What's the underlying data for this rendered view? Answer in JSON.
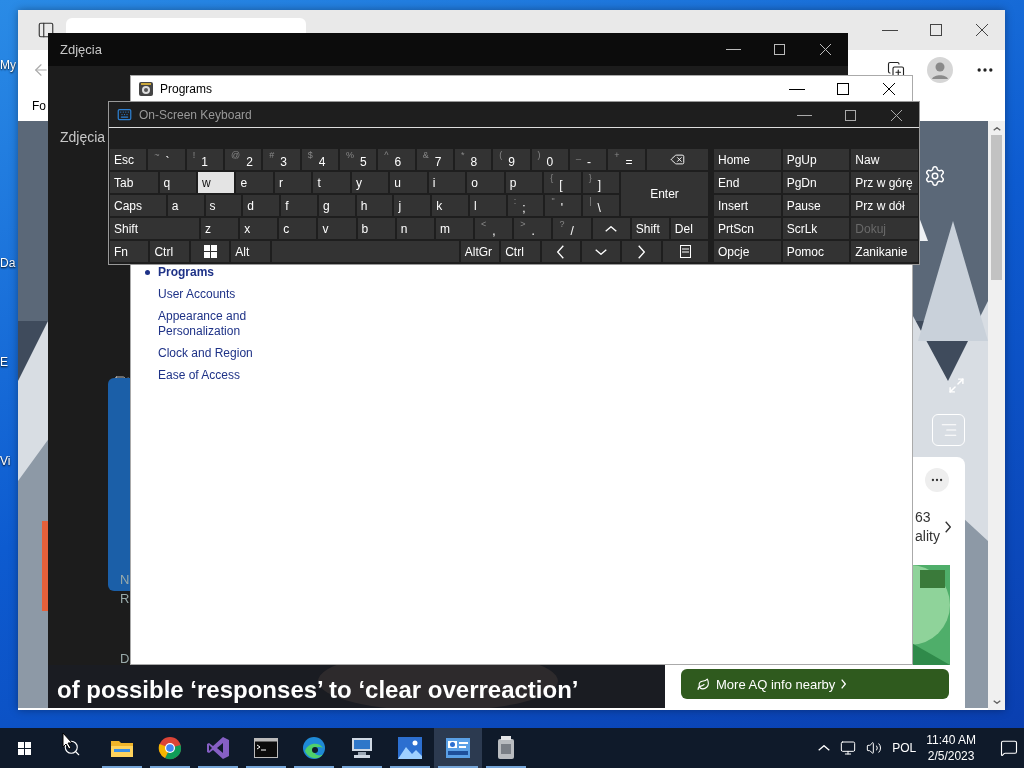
{
  "desktop": {
    "icon_labels": [
      "My",
      "Da",
      "E",
      "Vi"
    ]
  },
  "browser": {
    "favorites_text": "Fo",
    "headline": "of possible ‘responses’ to ‘clear overreaction’",
    "card": {
      "reading": "63",
      "caption": "ality",
      "button": "More AQ info nearby"
    }
  },
  "photos_window": {
    "title": "Zdjęcia",
    "nav_label": "Zdjęcia",
    "card_letters": [
      "N",
      "R"
    ],
    "footer_letter": "D"
  },
  "programs_window": {
    "title": "Programs",
    "nav": [
      {
        "label": "Programs",
        "selected": true
      },
      {
        "label": "User Accounts",
        "selected": false
      },
      {
        "label": "Appearance and Personalization",
        "selected": false
      },
      {
        "label": "Clock and Region",
        "selected": false
      },
      {
        "label": "Ease of Access",
        "selected": false
      }
    ]
  },
  "keyboard_window": {
    "title": "On-Screen Keyboard",
    "active": false,
    "main_rows": [
      [
        {
          "kind": "text",
          "label": "Esc",
          "selected": false
        },
        {
          "kind": "dual",
          "shift": "~",
          "label": "`",
          "selected": false
        },
        {
          "kind": "dual",
          "shift": "!",
          "label": "1",
          "selected": false
        },
        {
          "kind": "dual",
          "shift": "@",
          "label": "2",
          "selected": false
        },
        {
          "kind": "dual",
          "shift": "#",
          "label": "3",
          "selected": false
        },
        {
          "kind": "dual",
          "shift": "$",
          "label": "4",
          "selected": false
        },
        {
          "kind": "dual",
          "shift": "%",
          "label": "5",
          "selected": false
        },
        {
          "kind": "dual",
          "shift": "^",
          "label": "6",
          "selected": false
        },
        {
          "kind": "dual",
          "shift": "&",
          "label": "7",
          "selected": false
        },
        {
          "kind": "dual",
          "shift": "*",
          "label": "8",
          "selected": false
        },
        {
          "kind": "dual",
          "shift": "(",
          "label": "9",
          "selected": false
        },
        {
          "kind": "dual",
          "shift": ")",
          "label": "0",
          "selected": false
        },
        {
          "kind": "dual",
          "shift": "_",
          "label": "-",
          "selected": false
        },
        {
          "kind": "dual",
          "shift": "+",
          "label": "=",
          "selected": false
        },
        {
          "kind": "backspace",
          "selected": false
        }
      ],
      [
        {
          "kind": "text",
          "label": "Tab",
          "selected": false
        },
        {
          "kind": "text",
          "label": "q",
          "selected": false
        },
        {
          "kind": "text",
          "label": "w",
          "selected": true
        },
        {
          "kind": "text",
          "label": "e",
          "selected": false
        },
        {
          "kind": "text",
          "label": "r",
          "selected": false
        },
        {
          "kind": "text",
          "label": "t",
          "selected": false
        },
        {
          "kind": "text",
          "label": "y",
          "selected": false
        },
        {
          "kind": "text",
          "label": "u",
          "selected": false
        },
        {
          "kind": "text",
          "label": "i",
          "selected": false
        },
        {
          "kind": "text",
          "label": "o",
          "selected": false
        },
        {
          "kind": "text",
          "label": "p",
          "selected": false
        },
        {
          "kind": "dual",
          "shift": "{",
          "label": "[",
          "selected": false
        },
        {
          "kind": "dual",
          "shift": "}",
          "label": "]",
          "selected": false
        },
        {
          "kind": "enter",
          "label": "Enter",
          "selected": false
        }
      ],
      [
        {
          "kind": "text",
          "label": "Caps",
          "selected": false
        },
        {
          "kind": "text",
          "label": "a",
          "selected": false
        },
        {
          "kind": "text",
          "label": "s",
          "selected": false
        },
        {
          "kind": "text",
          "label": "d",
          "selected": false
        },
        {
          "kind": "text",
          "label": "f",
          "selected": false
        },
        {
          "kind": "text",
          "label": "g",
          "selected": false
        },
        {
          "kind": "text",
          "label": "h",
          "selected": false
        },
        {
          "kind": "text",
          "label": "j",
          "selected": false
        },
        {
          "kind": "text",
          "label": "k",
          "selected": false
        },
        {
          "kind": "text",
          "label": "l",
          "selected": false
        },
        {
          "kind": "dual",
          "shift": ":",
          "label": ";",
          "selected": false
        },
        {
          "kind": "dual",
          "shift": "\"",
          "label": "'",
          "selected": false
        },
        {
          "kind": "dual",
          "shift": "|",
          "label": "\\",
          "selected": false
        }
      ],
      [
        {
          "kind": "text",
          "label": "Shift",
          "selected": false
        },
        {
          "kind": "text",
          "label": "z",
          "selected": false
        },
        {
          "kind": "text",
          "label": "x",
          "selected": false
        },
        {
          "kind": "text",
          "label": "c",
          "selected": false
        },
        {
          "kind": "text",
          "label": "v",
          "selected": false
        },
        {
          "kind": "text",
          "label": "b",
          "selected": false
        },
        {
          "kind": "text",
          "label": "n",
          "selected": false
        },
        {
          "kind": "text",
          "label": "m",
          "selected": false
        },
        {
          "kind": "dual",
          "shift": "<",
          "label": ",",
          "selected": false
        },
        {
          "kind": "dual",
          "shift": ">",
          "label": ".",
          "selected": false
        },
        {
          "kind": "dual",
          "shift": "?",
          "label": "/",
          "selected": false
        },
        {
          "kind": "up",
          "selected": false
        },
        {
          "kind": "text",
          "label": "Shift",
          "selected": false
        },
        {
          "kind": "text",
          "label": "Del",
          "selected": false
        }
      ],
      [
        {
          "kind": "text",
          "label": "Fn",
          "selected": false
        },
        {
          "kind": "text",
          "label": "Ctrl",
          "selected": false
        },
        {
          "kind": "windows",
          "selected": false
        },
        {
          "kind": "text",
          "label": "Alt",
          "selected": false
        },
        {
          "kind": "space",
          "selected": false
        },
        {
          "kind": "text",
          "label": "AltGr",
          "selected": false
        },
        {
          "kind": "text",
          "label": "Ctrl",
          "selected": false
        },
        {
          "kind": "left",
          "selected": false
        },
        {
          "kind": "down",
          "selected": false
        },
        {
          "kind": "right",
          "selected": false
        },
        {
          "kind": "menu",
          "selected": false
        }
      ]
    ],
    "nav_keys": [
      {
        "label": "Home",
        "disabled": false
      },
      {
        "label": "PgUp",
        "disabled": false
      },
      {
        "label": "Naw",
        "disabled": false
      },
      {
        "label": "End",
        "disabled": false
      },
      {
        "label": "PgDn",
        "disabled": false
      },
      {
        "label": "Prz w górę",
        "disabled": false
      },
      {
        "label": "Insert",
        "disabled": false
      },
      {
        "label": "Pause",
        "disabled": false
      },
      {
        "label": "Prz w dół",
        "disabled": false
      },
      {
        "label": "PrtScn",
        "disabled": false
      },
      {
        "label": "ScrLk",
        "disabled": false
      },
      {
        "label": "Dokuj",
        "disabled": true
      },
      {
        "label": "Opcje",
        "disabled": false
      },
      {
        "label": "Pomoc",
        "disabled": false
      },
      {
        "label": "Zanikanie",
        "disabled": false
      }
    ]
  },
  "taskbar": {
    "apps": [
      {
        "kind": "folder",
        "selected": false
      },
      {
        "kind": "globe",
        "selected": false
      },
      {
        "kind": "ribbon",
        "selected": false
      },
      {
        "kind": "terminal",
        "selected": false
      },
      {
        "kind": "wave",
        "selected": false
      },
      {
        "kind": "computer",
        "selected": false
      },
      {
        "kind": "landscape",
        "selected": false
      },
      {
        "kind": "panel",
        "selected": true
      },
      {
        "kind": "jar",
        "selected": false
      }
    ],
    "language": "POL",
    "time": "11:40 AM",
    "date": "2/5/2023"
  }
}
